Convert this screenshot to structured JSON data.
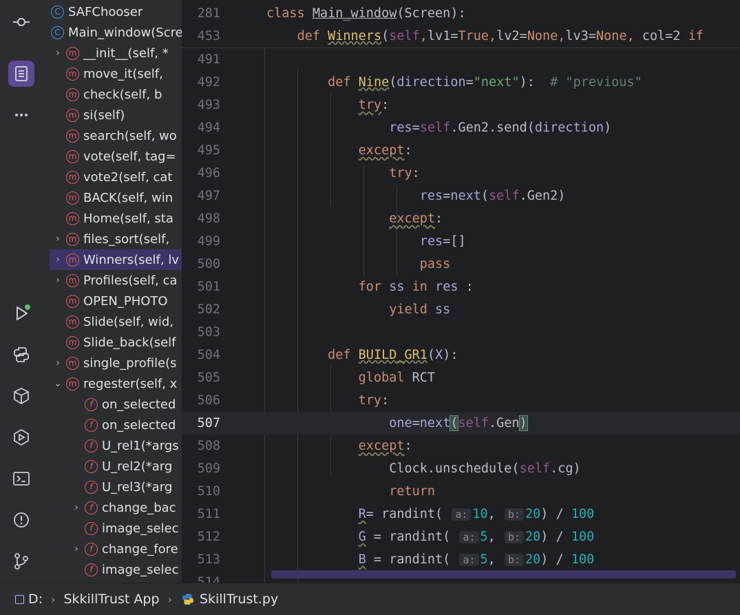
{
  "activity_bar": {
    "icons": [
      "commit-icon",
      "structure-icon",
      "more-icon",
      "run-icon",
      "python-console-icon",
      "python-packages-icon",
      "services-icon",
      "terminal-icon",
      "problems-icon",
      "git-icon"
    ]
  },
  "structure": {
    "items": [
      {
        "kind": "c",
        "label": "SAFChooser",
        "indent": 0,
        "chevron": ""
      },
      {
        "kind": "c",
        "label": "Main_window(Screen)",
        "indent": 0,
        "chevron": ""
      },
      {
        "kind": "m",
        "label": "__init__(self, *",
        "indent": 1,
        "chevron": "›"
      },
      {
        "kind": "m",
        "label": "move_it(self, ",
        "indent": 1,
        "chevron": ""
      },
      {
        "kind": "m",
        "label": "check(self, b",
        "indent": 1,
        "chevron": ""
      },
      {
        "kind": "m",
        "label": "si(self)",
        "indent": 1,
        "chevron": ""
      },
      {
        "kind": "m",
        "label": "search(self, wo",
        "indent": 1,
        "chevron": ""
      },
      {
        "kind": "m",
        "label": "vote(self, tag=",
        "indent": 1,
        "chevron": ""
      },
      {
        "kind": "m",
        "label": "vote2(self, cat",
        "indent": 1,
        "chevron": ""
      },
      {
        "kind": "m",
        "label": "BACK(self, win",
        "indent": 1,
        "chevron": ""
      },
      {
        "kind": "m",
        "label": "Home(self, sta",
        "indent": 1,
        "chevron": ""
      },
      {
        "kind": "m",
        "label": "files_sort(self,",
        "indent": 1,
        "chevron": "›"
      },
      {
        "kind": "m",
        "label": "Winners(self, lv",
        "indent": 1,
        "chevron": "›",
        "selected": true
      },
      {
        "kind": "m",
        "label": "Profiles(self, ca",
        "indent": 1,
        "chevron": "›"
      },
      {
        "kind": "m",
        "label": "OPEN_PHOTO",
        "indent": 1,
        "chevron": ""
      },
      {
        "kind": "m",
        "label": "Slide(self, wid,",
        "indent": 1,
        "chevron": ""
      },
      {
        "kind": "m",
        "label": "Slide_back(self",
        "indent": 1,
        "chevron": ""
      },
      {
        "kind": "m",
        "label": "single_profile(s",
        "indent": 1,
        "chevron": "›"
      },
      {
        "kind": "m",
        "label": "regester(self, x",
        "indent": 1,
        "chevron": "⌄"
      },
      {
        "kind": "f",
        "label": "on_selected",
        "indent": 2,
        "chevron": ""
      },
      {
        "kind": "f",
        "label": "on_selected",
        "indent": 2,
        "chevron": ""
      },
      {
        "kind": "f",
        "label": "U_rel1(*args",
        "indent": 2,
        "chevron": ""
      },
      {
        "kind": "f",
        "label": "U_rel2(*arg",
        "indent": 2,
        "chevron": ""
      },
      {
        "kind": "f",
        "label": "U_rel3(*arg",
        "indent": 2,
        "chevron": ""
      },
      {
        "kind": "f",
        "label": "change_bac",
        "indent": 2,
        "chevron": "›"
      },
      {
        "kind": "f",
        "label": "image_selec",
        "indent": 2,
        "chevron": ""
      },
      {
        "kind": "f",
        "label": "change_fore",
        "indent": 2,
        "chevron": "›"
      },
      {
        "kind": "f",
        "label": "image_selec",
        "indent": 2,
        "chevron": ""
      }
    ]
  },
  "editor": {
    "sticky": [
      {
        "ln": "281",
        "html": "<span class='kw'>class </span><span style='color:#bcbec4;text-decoration:underline'>Main_window</span>(Screen):"
      },
      {
        "ln": "453",
        "html": "    <span class='kw'>def </span><span class='fnu'>Winners</span>(<span class='selfk'>self</span><span class='kw'>,</span>lv1=<span class='kw'>True,</span>lv2=<span class='kw'>None,</span>lv3=<span class='kw'>None, </span>col=2 <span class='kw'>if</span>"
      }
    ],
    "current_line": "507",
    "lines": [
      {
        "ln": "491",
        "html": ""
      },
      {
        "ln": "492",
        "html": "        <span class='kw'>def </span><span class='fnu'>Nine</span>(<span class='param'>direction</span>=<span class='str'>\"next\"</span>):  <span class='cmt'># \"previous\"</span>"
      },
      {
        "ln": "493",
        "html": "            <span class='kw warn'>try</span>:"
      },
      {
        "ln": "494",
        "html": "                <span class='param'>res</span>=<span class='selfk'>self</span>.Gen2.send(<span class='param'>direction</span>)"
      },
      {
        "ln": "495",
        "html": "            <span class='kw warn'>except</span>:"
      },
      {
        "ln": "496",
        "html": "                <span class='kw'>try</span>:"
      },
      {
        "ln": "497",
        "html": "                    <span class='param'>res</span>=<span class='param'>next</span>(<span class='selfk'>self</span>.Gen2)"
      },
      {
        "ln": "498",
        "html": "                <span class='kw warn'>except</span>:"
      },
      {
        "ln": "499",
        "html": "                    <span class='param'>res</span>=[]"
      },
      {
        "ln": "500",
        "html": "                    <span class='kw'>pass</span>"
      },
      {
        "ln": "501",
        "html": "            <span class='kw'>for </span><span class='param'>ss</span><span class='kw'> in </span><span class='param'>res</span> :"
      },
      {
        "ln": "502",
        "html": "                <span class='kw'>yield </span><span class='param'>ss</span>"
      },
      {
        "ln": "503",
        "html": ""
      },
      {
        "ln": "504",
        "html": "        <span class='kw'>def </span><span class='fnu'>BUILD_GR1</span>(<span class='param'>X</span>):"
      },
      {
        "ln": "505",
        "html": "            <span class='kw'>global </span>RCT"
      },
      {
        "ln": "506",
        "html": "            <span class='kw'>try</span>:"
      },
      {
        "ln": "507",
        "html": "                <span class='param'>one</span>=<span class='param'>next</span><span class='bracket'>(</span><span class='selfk'>self</span>.Gen<span class='bracket'>)</span>"
      },
      {
        "ln": "508",
        "html": "            <span class='kw warn'>except</span>:"
      },
      {
        "ln": "509",
        "html": "                Clock.unschedule(<span class='selfk'>self</span>.cg)"
      },
      {
        "ln": "510",
        "html": "                <span class='kw'>return</span>"
      },
      {
        "ln": "511",
        "html": "            <span class='param warn'>R</span>= randint( <span class='hint'>a:</span><span class='num'>10</span>, <span class='hint'>b:</span><span class='num'>20</span>) / <span class='num'>100</span>"
      },
      {
        "ln": "512",
        "html": "            <span class='param warn'>G</span> = randint( <span class='hint'>a:</span><span class='num'>5</span>, <span class='hint'>b:</span><span class='num'>20</span>) / <span class='num'>100</span>"
      },
      {
        "ln": "513",
        "html": "            <span class='param warn'>B</span> = randint( <span class='hint'>a:</span><span class='num'>5</span>, <span class='hint'>b:</span><span class='num'>20</span>) / <span class='num'>100</span>"
      },
      {
        "ln": "514",
        "html": ""
      }
    ]
  },
  "breadcrumb": {
    "drive": "D:",
    "project": "SkkillTrust App",
    "file": "SkillTrust.py"
  }
}
